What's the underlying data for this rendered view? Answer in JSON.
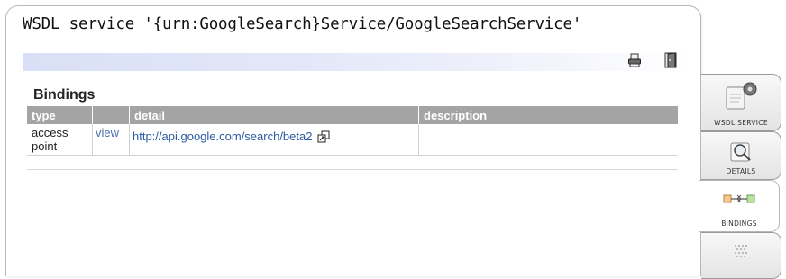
{
  "header": {
    "title": "WSDL service '{urn:GoogleSearch}Service/GoogleSearchService'"
  },
  "toolbar": {
    "print_icon": "printer-icon",
    "exit_icon": "door-exit-icon"
  },
  "bindings": {
    "section_title": "Bindings",
    "columns": [
      "type",
      "",
      "detail",
      "description"
    ],
    "rows": [
      {
        "type_line1": "access",
        "type_line2": "point",
        "view_label": "view",
        "detail": "http://api.google.com/search/beta2",
        "description": ""
      }
    ]
  },
  "tabs": [
    {
      "label": "WSDL SERVICE",
      "icon": "wsdl-service-gear-icon"
    },
    {
      "label": "DETAILS",
      "icon": "details-magnifier-icon"
    },
    {
      "label": "BINDINGS",
      "icon": "bindings-connector-icon",
      "active": true
    },
    {
      "label": "",
      "icon": "dotted-grid-icon"
    }
  ],
  "colors": {
    "table_header": "#a4a4a4",
    "link": "#2a5aa0",
    "toolbar_gradient_start": "#d9dff6"
  }
}
